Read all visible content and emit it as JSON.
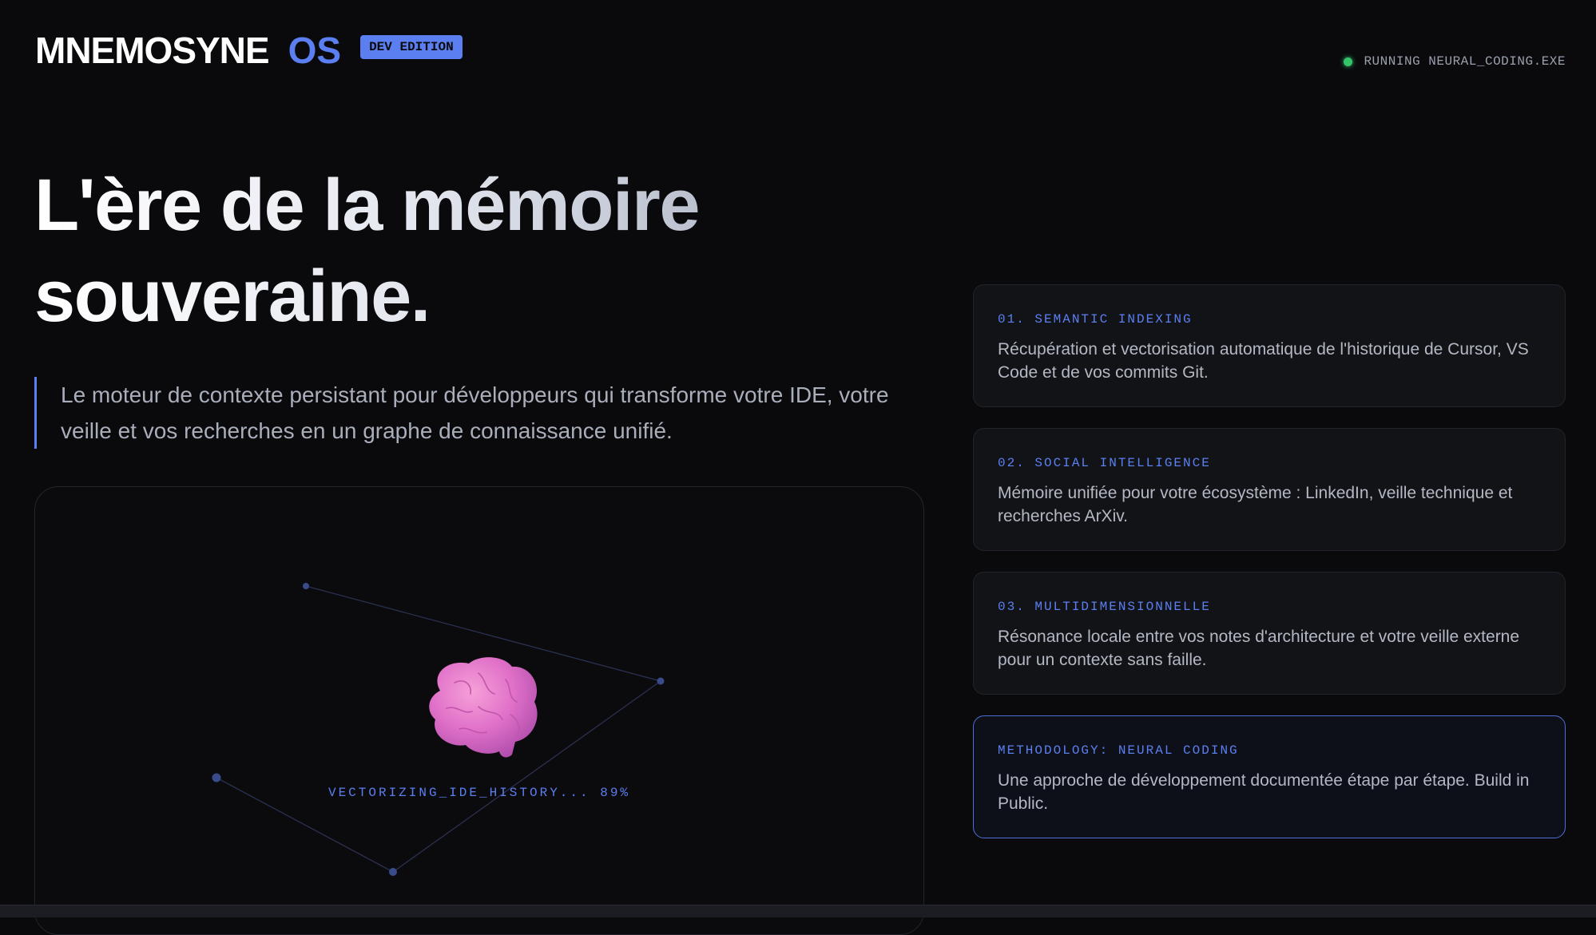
{
  "header": {
    "brand": "MNEMOSYNE",
    "brand_suffix": "OS",
    "badge": "DEV EDITION",
    "status_text": "RUNNING NEURAL_CODING.EXE"
  },
  "hero": {
    "title_line1": "L'ère de la mémoire",
    "title_line2": "souveraine.",
    "description": "Le moteur de contexte persistant pour développeurs qui transforme votre IDE, votre veille et vos recherches en un graphe de connaissance unifié."
  },
  "visual": {
    "icon": "brain-icon",
    "caption": "VECTORIZING_IDE_HISTORY... 89%",
    "progress": 0.89
  },
  "cards": [
    {
      "label": "01. SEMANTIC INDEXING",
      "text": "Récupération et vectorisation automatique de l'historique de Cursor, VS Code et de vos commits Git."
    },
    {
      "label": "02. SOCIAL INTELLIGENCE",
      "text": "Mémoire unifiée pour votre écosystème : LinkedIn, veille technique et recherches ArXiv."
    },
    {
      "label": "03. MULTIDIMENSIONNELLE",
      "text": "Résonance locale entre vos notes d'architecture et votre veille externe pour un contexte sans faille."
    },
    {
      "label": "METHODOLOGY: NEURAL CODING",
      "text": "Une approche de développement documentée étape par étape. Build in Public."
    }
  ],
  "colors": {
    "accent": "#5b7ff0",
    "status_ok": "#35c46a",
    "background": "#0a0a0d"
  }
}
